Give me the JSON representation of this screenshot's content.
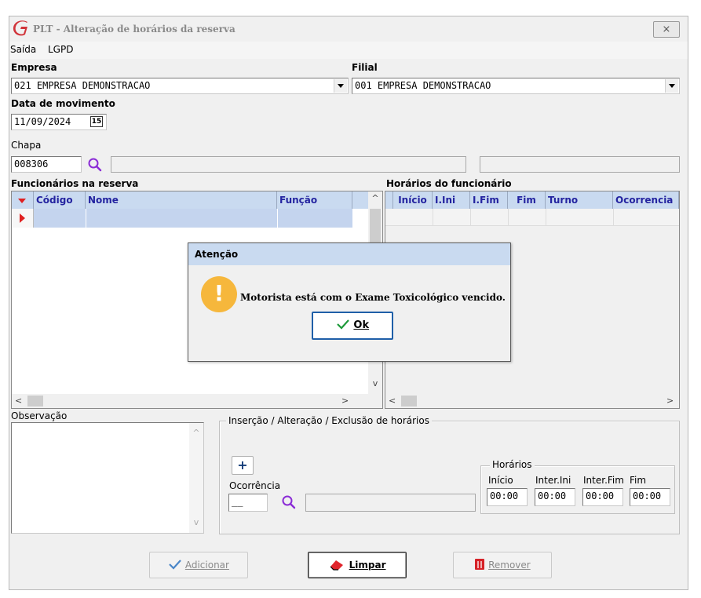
{
  "window": {
    "title": "PLT - Alteração de horários da reserva",
    "close_glyph": "⨯"
  },
  "menu": [
    "Saída",
    "LGPD"
  ],
  "empresa": {
    "label": "Empresa",
    "value": "021 EMPRESA DEMONSTRACAO"
  },
  "filial": {
    "label": "Filial",
    "value": "001 EMPRESA DEMONSTRACAO"
  },
  "data_movimento": {
    "label": "Data de movimento",
    "value": "11/09/2024",
    "calendar_glyph": "15"
  },
  "chapa": {
    "label": "Chapa",
    "value": "008306",
    "name": "",
    "extra": ""
  },
  "funcionarios": {
    "title": "Funcionários na reserva",
    "columns": [
      "Código",
      "Nome",
      "Função"
    ]
  },
  "horarios_func": {
    "title": "Horários do funcionário",
    "columns": [
      "Início",
      "I.Ini",
      "I.Fim",
      "Fim",
      "Turno",
      "Ocorrencia"
    ]
  },
  "observacao": {
    "label": "Observação",
    "value": ""
  },
  "insercao": {
    "legend": "Inserção / Alteração / Exclusão de horários",
    "add_glyph": "+",
    "ocorrencia_label": "Ocorrência",
    "ocorrencia_value": "__",
    "ocorrencia_desc": "",
    "horarios": {
      "legend": "Horários",
      "inicio_label": "Início",
      "inicio": "00:00",
      "inter_ini_label": "Inter.Ini",
      "inter_ini": "00:00",
      "inter_fim_label": "Inter.Fim",
      "inter_fim": "00:00",
      "fim_label": "Fim",
      "fim": "00:00"
    }
  },
  "buttons": {
    "adicionar": "Adicionar",
    "limpar": "Limpar",
    "remover": "Remover"
  },
  "dialog": {
    "title": "Atenção",
    "message": "Motorista está com o Exame Toxicológico vencido.",
    "ok": "Ok",
    "icon": "!"
  },
  "colors": {
    "grid_header": "#c9daf0",
    "header_text": "#2424a0",
    "selected_row": "#c4d4ee",
    "warning": "#f6b73c",
    "accent_blue": "#1f5fa8"
  }
}
